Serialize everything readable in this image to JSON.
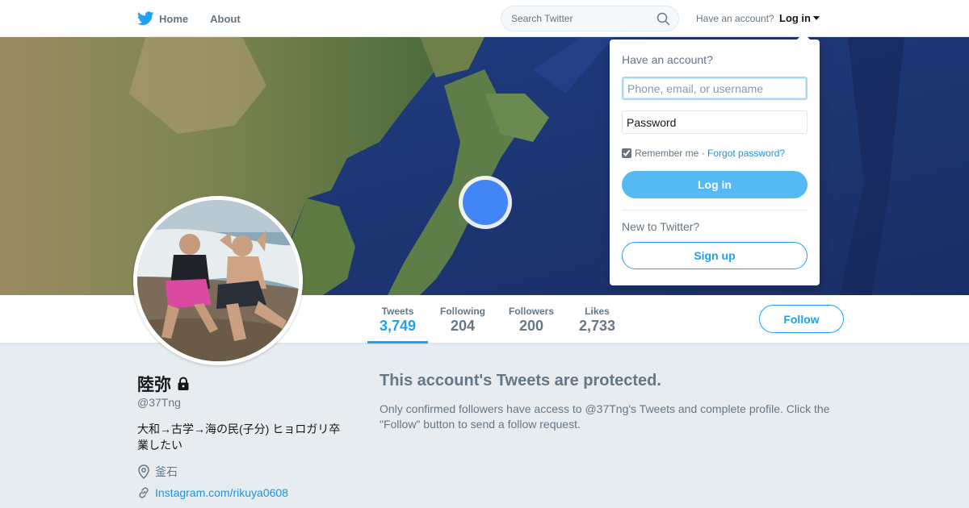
{
  "nav": {
    "home_label": "Home",
    "about_label": "About",
    "search_placeholder": "Search Twitter",
    "have_account": "Have an account?",
    "login_label": "Log in"
  },
  "profile": {
    "name": "陸弥",
    "screen_name": "@37Tng",
    "bio": "大和→古学→海の民(子分) ヒョロガリ卒業したい",
    "location": "釜石",
    "website": "Instagram.com/rikuya0608"
  },
  "stats": [
    {
      "label": "Tweets",
      "value": "3,749"
    },
    {
      "label": "Following",
      "value": "204"
    },
    {
      "label": "Followers",
      "value": "200"
    },
    {
      "label": "Likes",
      "value": "2,733"
    }
  ],
  "follow_label": "Follow",
  "protected": {
    "title": "This account's Tweets are protected.",
    "text": "Only confirmed followers have access to @37Tng's Tweets and complete profile. Click the \"Follow\" button to send a follow request."
  },
  "login_box": {
    "heading": "Have an account?",
    "username_placeholder": "Phone, email, or username",
    "password_placeholder": "Password",
    "remember_label": "Remember me",
    "separator": " · ",
    "forgot_label": "Forgot password?",
    "login_button": "Log in",
    "new_label": "New to Twitter?",
    "signup_button": "Sign up"
  },
  "colors": {
    "accent": "#1da1f2",
    "login_button": "#55b9f3",
    "background": "#e6ecf0"
  }
}
